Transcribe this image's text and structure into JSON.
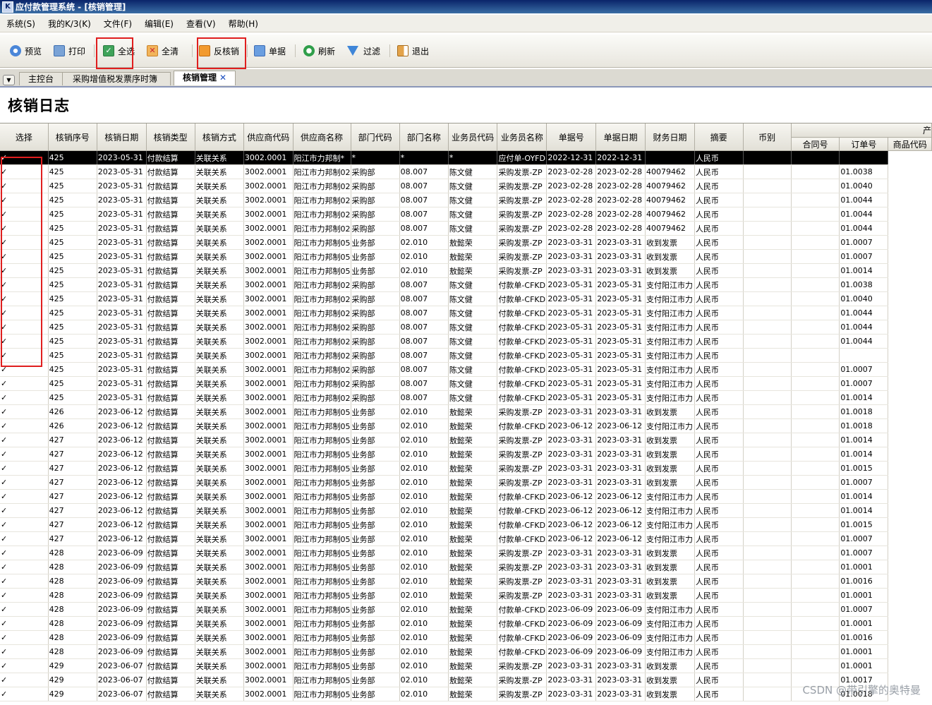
{
  "window": {
    "title": "应付款管理系统 - [核销管理]",
    "icon": "k3-app-icon"
  },
  "menu": [
    "系统(S)",
    "我的K/3(K)",
    "文件(F)",
    "编辑(E)",
    "查看(V)",
    "帮助(H)"
  ],
  "toolbar": {
    "preview": "预览",
    "print": "打印",
    "select_all": "全选",
    "clear_all": "全清",
    "reverse_verify": "反核销",
    "voucher": "单据",
    "refresh": "刷新",
    "filter": "过滤",
    "exit": "退出"
  },
  "tabs": {
    "console": "主控台",
    "ledger": "采购增值税发票序时簿",
    "verify": "核销管理"
  },
  "page_title": "核销日志",
  "columns": [
    "选择",
    "核销序号",
    "核销日期",
    "核销类型",
    "核销方式",
    "供应商代码",
    "供应商名称",
    "部门代码",
    "部门名称",
    "业务员代码",
    "业务员名称",
    "单据号",
    "单据日期",
    "财务日期",
    "摘要",
    "币别"
  ],
  "group_header": "产",
  "sub_columns": [
    "合同号",
    "订单号",
    "商品代码"
  ],
  "rows": [
    [
      "✓",
      "425",
      "2023-05-31",
      "付款结算",
      "关联关系",
      "3002.0001",
      "阳江市力邦制*",
      "*",
      "*",
      "*",
      "应付单-OYFD",
      "2022-12-31",
      "2022-12-31",
      "",
      "人民币",
      "",
      "",
      ""
    ],
    [
      "✓",
      "425",
      "2023-05-31",
      "付款结算",
      "关联关系",
      "3002.0001",
      "阳江市力邦制02",
      "采购部",
      "08.007",
      "陈文健",
      "采购发票-ZP",
      "2023-02-28",
      "2023-02-28",
      "40079462",
      "人民币",
      "",
      "",
      "01.0038"
    ],
    [
      "✓",
      "425",
      "2023-05-31",
      "付款结算",
      "关联关系",
      "3002.0001",
      "阳江市力邦制02",
      "采购部",
      "08.007",
      "陈文健",
      "采购发票-ZP",
      "2023-02-28",
      "2023-02-28",
      "40079462",
      "人民币",
      "",
      "",
      "01.0040"
    ],
    [
      "✓",
      "425",
      "2023-05-31",
      "付款结算",
      "关联关系",
      "3002.0001",
      "阳江市力邦制02",
      "采购部",
      "08.007",
      "陈文健",
      "采购发票-ZP",
      "2023-02-28",
      "2023-02-28",
      "40079462",
      "人民币",
      "",
      "",
      "01.0044"
    ],
    [
      "✓",
      "425",
      "2023-05-31",
      "付款结算",
      "关联关系",
      "3002.0001",
      "阳江市力邦制02",
      "采购部",
      "08.007",
      "陈文健",
      "采购发票-ZP",
      "2023-02-28",
      "2023-02-28",
      "40079462",
      "人民币",
      "",
      "",
      "01.0044"
    ],
    [
      "✓",
      "425",
      "2023-05-31",
      "付款结算",
      "关联关系",
      "3002.0001",
      "阳江市力邦制02",
      "采购部",
      "08.007",
      "陈文健",
      "采购发票-ZP",
      "2023-02-28",
      "2023-02-28",
      "40079462",
      "人民币",
      "",
      "",
      "01.0044"
    ],
    [
      "✓",
      "425",
      "2023-05-31",
      "付款结算",
      "关联关系",
      "3002.0001",
      "阳江市力邦制05",
      "业务部",
      "02.010",
      "敖懿荣",
      "采购发票-ZP",
      "2023-03-31",
      "2023-03-31",
      "收到发票",
      "人民币",
      "",
      "",
      "01.0007"
    ],
    [
      "✓",
      "425",
      "2023-05-31",
      "付款结算",
      "关联关系",
      "3002.0001",
      "阳江市力邦制05",
      "业务部",
      "02.010",
      "敖懿荣",
      "采购发票-ZP",
      "2023-03-31",
      "2023-03-31",
      "收到发票",
      "人民币",
      "",
      "",
      "01.0007"
    ],
    [
      "✓",
      "425",
      "2023-05-31",
      "付款结算",
      "关联关系",
      "3002.0001",
      "阳江市力邦制05",
      "业务部",
      "02.010",
      "敖懿荣",
      "采购发票-ZP",
      "2023-03-31",
      "2023-03-31",
      "收到发票",
      "人民币",
      "",
      "",
      "01.0014"
    ],
    [
      "✓",
      "425",
      "2023-05-31",
      "付款结算",
      "关联关系",
      "3002.0001",
      "阳江市力邦制02",
      "采购部",
      "08.007",
      "陈文健",
      "付款单-CFKD",
      "2023-05-31",
      "2023-05-31",
      "支付阳江市力",
      "人民币",
      "",
      "",
      "01.0038"
    ],
    [
      "✓",
      "425",
      "2023-05-31",
      "付款结算",
      "关联关系",
      "3002.0001",
      "阳江市力邦制02",
      "采购部",
      "08.007",
      "陈文健",
      "付款单-CFKD",
      "2023-05-31",
      "2023-05-31",
      "支付阳江市力",
      "人民币",
      "",
      "",
      "01.0040"
    ],
    [
      "✓",
      "425",
      "2023-05-31",
      "付款结算",
      "关联关系",
      "3002.0001",
      "阳江市力邦制02",
      "采购部",
      "08.007",
      "陈文健",
      "付款单-CFKD",
      "2023-05-31",
      "2023-05-31",
      "支付阳江市力",
      "人民币",
      "",
      "",
      "01.0044"
    ],
    [
      "✓",
      "425",
      "2023-05-31",
      "付款结算",
      "关联关系",
      "3002.0001",
      "阳江市力邦制02",
      "采购部",
      "08.007",
      "陈文健",
      "付款单-CFKD",
      "2023-05-31",
      "2023-05-31",
      "支付阳江市力",
      "人民币",
      "",
      "",
      "01.0044"
    ],
    [
      "✓",
      "425",
      "2023-05-31",
      "付款结算",
      "关联关系",
      "3002.0001",
      "阳江市力邦制02",
      "采购部",
      "08.007",
      "陈文健",
      "付款单-CFKD",
      "2023-05-31",
      "2023-05-31",
      "支付阳江市力",
      "人民币",
      "",
      "",
      "01.0044"
    ],
    [
      "✓",
      "425",
      "2023-05-31",
      "付款结算",
      "关联关系",
      "3002.0001",
      "阳江市力邦制02",
      "采购部",
      "08.007",
      "陈文健",
      "付款单-CFKD",
      "2023-05-31",
      "2023-05-31",
      "支付阳江市力",
      "人民币",
      "",
      "",
      ""
    ],
    [
      "✓",
      "425",
      "2023-05-31",
      "付款结算",
      "关联关系",
      "3002.0001",
      "阳江市力邦制02",
      "采购部",
      "08.007",
      "陈文健",
      "付款单-CFKD",
      "2023-05-31",
      "2023-05-31",
      "支付阳江市力",
      "人民币",
      "",
      "",
      "01.0007"
    ],
    [
      "✓",
      "425",
      "2023-05-31",
      "付款结算",
      "关联关系",
      "3002.0001",
      "阳江市力邦制02",
      "采购部",
      "08.007",
      "陈文健",
      "付款单-CFKD",
      "2023-05-31",
      "2023-05-31",
      "支付阳江市力",
      "人民币",
      "",
      "",
      "01.0007"
    ],
    [
      "✓",
      "425",
      "2023-05-31",
      "付款结算",
      "关联关系",
      "3002.0001",
      "阳江市力邦制02",
      "采购部",
      "08.007",
      "陈文健",
      "付款单-CFKD",
      "2023-05-31",
      "2023-05-31",
      "支付阳江市力",
      "人民币",
      "",
      "",
      "01.0014"
    ],
    [
      "✓",
      "426",
      "2023-06-12",
      "付款结算",
      "关联关系",
      "3002.0001",
      "阳江市力邦制05",
      "业务部",
      "02.010",
      "敖懿荣",
      "采购发票-ZP",
      "2023-03-31",
      "2023-03-31",
      "收到发票",
      "人民币",
      "",
      "",
      "01.0018"
    ],
    [
      "✓",
      "426",
      "2023-06-12",
      "付款结算",
      "关联关系",
      "3002.0001",
      "阳江市力邦制05",
      "业务部",
      "02.010",
      "敖懿荣",
      "付款单-CFKD",
      "2023-06-12",
      "2023-06-12",
      "支付阳江市力",
      "人民币",
      "",
      "",
      "01.0018"
    ],
    [
      "✓",
      "427",
      "2023-06-12",
      "付款结算",
      "关联关系",
      "3002.0001",
      "阳江市力邦制05",
      "业务部",
      "02.010",
      "敖懿荣",
      "采购发票-ZP",
      "2023-03-31",
      "2023-03-31",
      "收到发票",
      "人民币",
      "",
      "",
      "01.0014"
    ],
    [
      "✓",
      "427",
      "2023-06-12",
      "付款结算",
      "关联关系",
      "3002.0001",
      "阳江市力邦制05",
      "业务部",
      "02.010",
      "敖懿荣",
      "采购发票-ZP",
      "2023-03-31",
      "2023-03-31",
      "收到发票",
      "人民币",
      "",
      "",
      "01.0014"
    ],
    [
      "✓",
      "427",
      "2023-06-12",
      "付款结算",
      "关联关系",
      "3002.0001",
      "阳江市力邦制05",
      "业务部",
      "02.010",
      "敖懿荣",
      "采购发票-ZP",
      "2023-03-31",
      "2023-03-31",
      "收到发票",
      "人民币",
      "",
      "",
      "01.0015"
    ],
    [
      "✓",
      "427",
      "2023-06-12",
      "付款结算",
      "关联关系",
      "3002.0001",
      "阳江市力邦制05",
      "业务部",
      "02.010",
      "敖懿荣",
      "采购发票-ZP",
      "2023-03-31",
      "2023-03-31",
      "收到发票",
      "人民币",
      "",
      "",
      "01.0007"
    ],
    [
      "✓",
      "427",
      "2023-06-12",
      "付款结算",
      "关联关系",
      "3002.0001",
      "阳江市力邦制05",
      "业务部",
      "02.010",
      "敖懿荣",
      "付款单-CFKD",
      "2023-06-12",
      "2023-06-12",
      "支付阳江市力",
      "人民币",
      "",
      "",
      "01.0014"
    ],
    [
      "✓",
      "427",
      "2023-06-12",
      "付款结算",
      "关联关系",
      "3002.0001",
      "阳江市力邦制05",
      "业务部",
      "02.010",
      "敖懿荣",
      "付款单-CFKD",
      "2023-06-12",
      "2023-06-12",
      "支付阳江市力",
      "人民币",
      "",
      "",
      "01.0014"
    ],
    [
      "✓",
      "427",
      "2023-06-12",
      "付款结算",
      "关联关系",
      "3002.0001",
      "阳江市力邦制05",
      "业务部",
      "02.010",
      "敖懿荣",
      "付款单-CFKD",
      "2023-06-12",
      "2023-06-12",
      "支付阳江市力",
      "人民币",
      "",
      "",
      "01.0015"
    ],
    [
      "✓",
      "427",
      "2023-06-12",
      "付款结算",
      "关联关系",
      "3002.0001",
      "阳江市力邦制05",
      "业务部",
      "02.010",
      "敖懿荣",
      "付款单-CFKD",
      "2023-06-12",
      "2023-06-12",
      "支付阳江市力",
      "人民币",
      "",
      "",
      "01.0007"
    ],
    [
      "✓",
      "428",
      "2023-06-09",
      "付款结算",
      "关联关系",
      "3002.0001",
      "阳江市力邦制05",
      "业务部",
      "02.010",
      "敖懿荣",
      "采购发票-ZP",
      "2023-03-31",
      "2023-03-31",
      "收到发票",
      "人民币",
      "",
      "",
      "01.0007"
    ],
    [
      "✓",
      "428",
      "2023-06-09",
      "付款结算",
      "关联关系",
      "3002.0001",
      "阳江市力邦制05",
      "业务部",
      "02.010",
      "敖懿荣",
      "采购发票-ZP",
      "2023-03-31",
      "2023-03-31",
      "收到发票",
      "人民币",
      "",
      "",
      "01.0001"
    ],
    [
      "✓",
      "428",
      "2023-06-09",
      "付款结算",
      "关联关系",
      "3002.0001",
      "阳江市力邦制05",
      "业务部",
      "02.010",
      "敖懿荣",
      "采购发票-ZP",
      "2023-03-31",
      "2023-03-31",
      "收到发票",
      "人民币",
      "",
      "",
      "01.0016"
    ],
    [
      "✓",
      "428",
      "2023-06-09",
      "付款结算",
      "关联关系",
      "3002.0001",
      "阳江市力邦制05",
      "业务部",
      "02.010",
      "敖懿荣",
      "采购发票-ZP",
      "2023-03-31",
      "2023-03-31",
      "收到发票",
      "人民币",
      "",
      "",
      "01.0001"
    ],
    [
      "✓",
      "428",
      "2023-06-09",
      "付款结算",
      "关联关系",
      "3002.0001",
      "阳江市力邦制05",
      "业务部",
      "02.010",
      "敖懿荣",
      "付款单-CFKD",
      "2023-06-09",
      "2023-06-09",
      "支付阳江市力",
      "人民币",
      "",
      "",
      "01.0007"
    ],
    [
      "✓",
      "428",
      "2023-06-09",
      "付款结算",
      "关联关系",
      "3002.0001",
      "阳江市力邦制05",
      "业务部",
      "02.010",
      "敖懿荣",
      "付款单-CFKD",
      "2023-06-09",
      "2023-06-09",
      "支付阳江市力",
      "人民币",
      "",
      "",
      "01.0001"
    ],
    [
      "✓",
      "428",
      "2023-06-09",
      "付款结算",
      "关联关系",
      "3002.0001",
      "阳江市力邦制05",
      "业务部",
      "02.010",
      "敖懿荣",
      "付款单-CFKD",
      "2023-06-09",
      "2023-06-09",
      "支付阳江市力",
      "人民币",
      "",
      "",
      "01.0016"
    ],
    [
      "✓",
      "428",
      "2023-06-09",
      "付款结算",
      "关联关系",
      "3002.0001",
      "阳江市力邦制05",
      "业务部",
      "02.010",
      "敖懿荣",
      "付款单-CFKD",
      "2023-06-09",
      "2023-06-09",
      "支付阳江市力",
      "人民币",
      "",
      "",
      "01.0001"
    ],
    [
      "✓",
      "429",
      "2023-06-07",
      "付款结算",
      "关联关系",
      "3002.0001",
      "阳江市力邦制05",
      "业务部",
      "02.010",
      "敖懿荣",
      "采购发票-ZP",
      "2023-03-31",
      "2023-03-31",
      "收到发票",
      "人民币",
      "",
      "",
      "01.0001"
    ],
    [
      "✓",
      "429",
      "2023-06-07",
      "付款结算",
      "关联关系",
      "3002.0001",
      "阳江市力邦制05",
      "业务部",
      "02.010",
      "敖懿荣",
      "采购发票-ZP",
      "2023-03-31",
      "2023-03-31",
      "收到发票",
      "人民币",
      "",
      "",
      "01.0017"
    ],
    [
      "✓",
      "429",
      "2023-06-07",
      "付款结算",
      "关联关系",
      "3002.0001",
      "阳江市力邦制05",
      "业务部",
      "02.010",
      "敖懿荣",
      "采购发票-ZP",
      "2023-03-31",
      "2023-03-31",
      "收到发票",
      "人民币",
      "",
      "",
      "01.0018"
    ]
  ],
  "watermark": "CSDN @带引擎的奥特曼"
}
